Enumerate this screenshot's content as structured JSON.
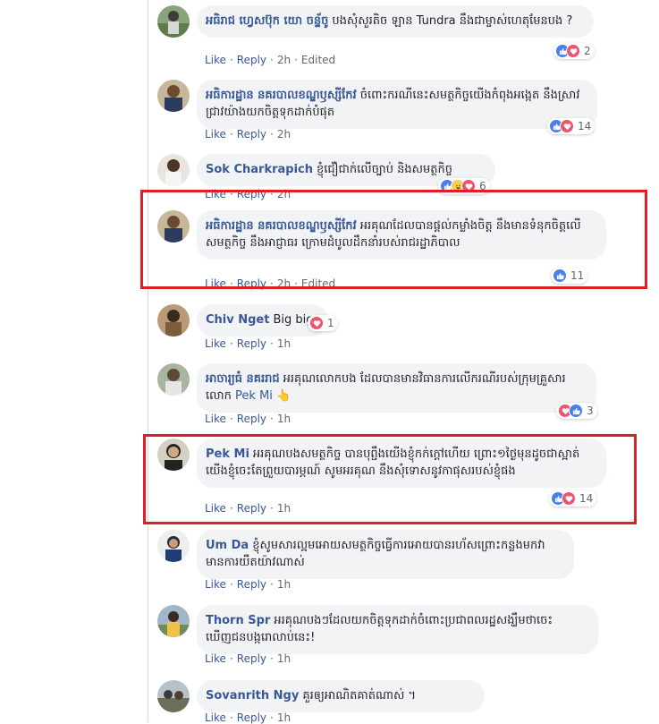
{
  "actions": {
    "like": "Like",
    "reply": "Reply",
    "separator": "·",
    "edited": "Edited"
  },
  "comments": [
    {
      "name": "អធិរាជ ហ្វេសប៊ុក យោ ចន្ទ័ចូ",
      "text": "បងសុំសួរតិច ឡាន Tundra នឹងជាម្ចាស់ហេតុមែនបង ?",
      "time": "2h",
      "edited": true,
      "reaction_count": "2",
      "highlighted": false
    },
    {
      "name": "អធិការដ្ឋាន នគរបាលខណ្ឌឫស្សីកែវ",
      "text": "ចំពោះករណីនេះសមត្ថកិច្ចយើងកំពុងអង្កេត នឹងស្រាវជ្រាវយ៉ាងយកចិត្តទុកដាក់បំផុត",
      "time": "2h",
      "edited": false,
      "reaction_count": "14",
      "highlighted": false
    },
    {
      "name": "Sok Charkrapich",
      "text": "ខ្ញុំជឿជាក់លើច្បាប់ និងសមត្ថកិច្ច",
      "time": "2h",
      "edited": false,
      "reaction_count": "6",
      "highlighted": false
    },
    {
      "name": "អធិការដ្ឋាន នគរបាលខណ្ឌឫស្សីកែវ",
      "text": "អរគុណដែលបានផ្តល់កម្លាំងចិត្ត នឹងមានទំនុកចិត្តលើសមត្ថកិច្ច នឹងអាជ្ញាធរ ក្រោមដំបូលដឹកនាំរបស់រាជរដ្ឋាភិបាល",
      "time": "2h",
      "edited": true,
      "reaction_count": "11",
      "highlighted": true
    },
    {
      "name": "Chiv Nget",
      "text": "Big big",
      "time": "1h",
      "edited": false,
      "reaction_count": "1",
      "highlighted": false
    },
    {
      "name": "អាចារ្យធំ នគររាជ",
      "text": "អរគុណលោកបង ដែលបានមានវិធានការលើករណីរបស់ក្រុមគ្រួសារលោក",
      "tag": "Pek Mi",
      "emoji": "👆",
      "time": "1h",
      "edited": false,
      "reaction_count": "3",
      "highlighted": false
    },
    {
      "name": "Pek Mi",
      "text": "អរគុណបងសមត្ថកិច្ច បានបុព្ជឹងយើងខ្ញុំកក់ក្តៅហើយ ព្រោះ១ថ្ងៃមុនដូចជាស្អាត់ យើងខ្ញុំចេះតែព្រួយបារម្ភណ៍ សូមអរគុណ នឹងសុំទោសនូវកាផុសរបស់ខ្ញុំផង",
      "time": "1h",
      "edited": false,
      "reaction_count": "14",
      "highlighted": true
    },
    {
      "name": "Um Da",
      "text": "ខ្ញុំសូមសារល្អមអោយសមត្ថកិច្ចធ្វើការអោយបានរហ័សព្រោះកន្លងមកវាមានការយឺតយ៉ាវណាស់",
      "time": "1h",
      "edited": false,
      "reaction_count": "",
      "highlighted": false
    },
    {
      "name": "Thorn Spr",
      "text": "អរគុណបងៗដែលយកចិត្តទុកដាក់ចំពោះប្រជាពលរដ្ឋសង្ឃឹមថាចេះឃើញជនបង្ករោលាប់នេះ!",
      "time": "1h",
      "edited": false,
      "reaction_count": "",
      "highlighted": false
    },
    {
      "name": "Sovanrith Ngy",
      "text": "គួរឲ្យអាណិតគាត់ណាស់ ។",
      "time": "1h",
      "edited": false,
      "reaction_count": "",
      "highlighted": false
    }
  ],
  "colors": {
    "link": "#385898",
    "bubble": "#f2f3f5",
    "highlight_border": "#e11d26",
    "like": "#4a7eed",
    "love": "#f0536b"
  }
}
